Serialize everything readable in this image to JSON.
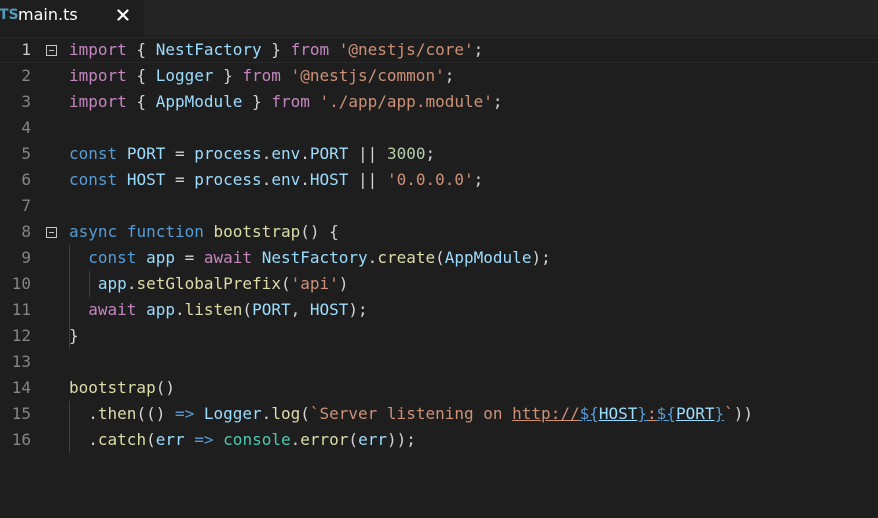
{
  "tab": {
    "icon": "TS",
    "icon_name": "typescript-file-icon",
    "label": "main.ts",
    "close_icon": "close-icon"
  },
  "editor": {
    "fold_icon": "fold-collapse-icon",
    "lines": [
      {
        "number": "1",
        "tokens": [
          {
            "t": "import",
            "c": "kw2"
          },
          {
            "t": " { ",
            "c": "p"
          },
          {
            "t": "NestFactory",
            "c": "id"
          },
          {
            "t": " } ",
            "c": "p"
          },
          {
            "t": "from",
            "c": "kw2"
          },
          {
            "t": " ",
            "c": "p"
          },
          {
            "t": "'@nestjs/core'",
            "c": "str"
          },
          {
            "t": ";",
            "c": "p"
          }
        ]
      },
      {
        "number": "2",
        "tokens": [
          {
            "t": "import",
            "c": "kw2"
          },
          {
            "t": " { ",
            "c": "p"
          },
          {
            "t": "Logger",
            "c": "id"
          },
          {
            "t": " } ",
            "c": "p"
          },
          {
            "t": "from",
            "c": "kw2"
          },
          {
            "t": " ",
            "c": "p"
          },
          {
            "t": "'@nestjs/common'",
            "c": "str"
          },
          {
            "t": ";",
            "c": "p"
          }
        ]
      },
      {
        "number": "3",
        "tokens": [
          {
            "t": "import",
            "c": "kw2"
          },
          {
            "t": " { ",
            "c": "p"
          },
          {
            "t": "AppModule",
            "c": "id"
          },
          {
            "t": " } ",
            "c": "p"
          },
          {
            "t": "from",
            "c": "kw2"
          },
          {
            "t": " ",
            "c": "p"
          },
          {
            "t": "'./app/app.module'",
            "c": "str"
          },
          {
            "t": ";",
            "c": "p"
          }
        ]
      },
      {
        "number": "4",
        "tokens": []
      },
      {
        "number": "5",
        "tokens": [
          {
            "t": "const",
            "c": "kw"
          },
          {
            "t": " ",
            "c": "p"
          },
          {
            "t": "PORT",
            "c": "id"
          },
          {
            "t": " = ",
            "c": "p"
          },
          {
            "t": "process",
            "c": "id"
          },
          {
            "t": ".",
            "c": "p"
          },
          {
            "t": "env",
            "c": "id"
          },
          {
            "t": ".",
            "c": "p"
          },
          {
            "t": "PORT",
            "c": "id"
          },
          {
            "t": " || ",
            "c": "p"
          },
          {
            "t": "3000",
            "c": "num"
          },
          {
            "t": ";",
            "c": "p"
          }
        ]
      },
      {
        "number": "6",
        "tokens": [
          {
            "t": "const",
            "c": "kw"
          },
          {
            "t": " ",
            "c": "p"
          },
          {
            "t": "HOST",
            "c": "id"
          },
          {
            "t": " = ",
            "c": "p"
          },
          {
            "t": "process",
            "c": "id"
          },
          {
            "t": ".",
            "c": "p"
          },
          {
            "t": "env",
            "c": "id"
          },
          {
            "t": ".",
            "c": "p"
          },
          {
            "t": "HOST",
            "c": "id"
          },
          {
            "t": " || ",
            "c": "p"
          },
          {
            "t": "'0.0.0.0'",
            "c": "str"
          },
          {
            "t": ";",
            "c": "p"
          }
        ]
      },
      {
        "number": "7",
        "tokens": []
      },
      {
        "number": "8",
        "tokens": [
          {
            "t": "async",
            "c": "kw"
          },
          {
            "t": " ",
            "c": "p"
          },
          {
            "t": "function",
            "c": "kw"
          },
          {
            "t": " ",
            "c": "p"
          },
          {
            "t": "bootstrap",
            "c": "fn"
          },
          {
            "t": "() {",
            "c": "p"
          }
        ]
      },
      {
        "number": "9",
        "tokens": [
          {
            "t": "  ",
            "c": "p"
          },
          {
            "t": "const",
            "c": "kw"
          },
          {
            "t": " ",
            "c": "p"
          },
          {
            "t": "app",
            "c": "id"
          },
          {
            "t": " = ",
            "c": "p"
          },
          {
            "t": "await",
            "c": "kw2"
          },
          {
            "t": " ",
            "c": "p"
          },
          {
            "t": "NestFactory",
            "c": "id"
          },
          {
            "t": ".",
            "c": "p"
          },
          {
            "t": "create",
            "c": "fn"
          },
          {
            "t": "(",
            "c": "p"
          },
          {
            "t": "AppModule",
            "c": "id"
          },
          {
            "t": ");",
            "c": "p"
          }
        ]
      },
      {
        "number": "10",
        "tokens": [
          {
            "t": "   ",
            "c": "p"
          },
          {
            "t": "app",
            "c": "id"
          },
          {
            "t": ".",
            "c": "p"
          },
          {
            "t": "setGlobalPrefix",
            "c": "fn"
          },
          {
            "t": "(",
            "c": "p"
          },
          {
            "t": "'api'",
            "c": "str"
          },
          {
            "t": ")",
            "c": "p"
          }
        ]
      },
      {
        "number": "11",
        "tokens": [
          {
            "t": "  ",
            "c": "p"
          },
          {
            "t": "await",
            "c": "kw2"
          },
          {
            "t": " ",
            "c": "p"
          },
          {
            "t": "app",
            "c": "id"
          },
          {
            "t": ".",
            "c": "p"
          },
          {
            "t": "listen",
            "c": "fn"
          },
          {
            "t": "(",
            "c": "p"
          },
          {
            "t": "PORT",
            "c": "id"
          },
          {
            "t": ", ",
            "c": "p"
          },
          {
            "t": "HOST",
            "c": "id"
          },
          {
            "t": ");",
            "c": "p"
          }
        ]
      },
      {
        "number": "12",
        "tokens": [
          {
            "t": "}",
            "c": "p"
          }
        ]
      },
      {
        "number": "13",
        "tokens": []
      },
      {
        "number": "14",
        "tokens": [
          {
            "t": "bootstrap",
            "c": "fn"
          },
          {
            "t": "()",
            "c": "p"
          }
        ]
      },
      {
        "number": "15",
        "tokens": [
          {
            "t": "  .",
            "c": "p"
          },
          {
            "t": "then",
            "c": "fn"
          },
          {
            "t": "(() ",
            "c": "p"
          },
          {
            "t": "=>",
            "c": "kw"
          },
          {
            "t": " ",
            "c": "p"
          },
          {
            "t": "Logger",
            "c": "id"
          },
          {
            "t": ".",
            "c": "p"
          },
          {
            "t": "log",
            "c": "fn"
          },
          {
            "t": "(",
            "c": "p"
          },
          {
            "t": "`Server listening on ",
            "c": "str"
          },
          {
            "t": "http://",
            "c": "str link"
          },
          {
            "t": "${",
            "c": "kw link"
          },
          {
            "t": "HOST",
            "c": "id link"
          },
          {
            "t": "}",
            "c": "kw link"
          },
          {
            "t": ":",
            "c": "str link"
          },
          {
            "t": "${",
            "c": "kw link"
          },
          {
            "t": "PORT",
            "c": "id link"
          },
          {
            "t": "}",
            "c": "kw link"
          },
          {
            "t": "`",
            "c": "str"
          },
          {
            "t": "))",
            "c": "p"
          }
        ]
      },
      {
        "number": "16",
        "tokens": [
          {
            "t": "  .",
            "c": "p"
          },
          {
            "t": "catch",
            "c": "fn"
          },
          {
            "t": "(",
            "c": "p"
          },
          {
            "t": "err",
            "c": "id"
          },
          {
            "t": " ",
            "c": "p"
          },
          {
            "t": "=>",
            "c": "kw"
          },
          {
            "t": " ",
            "c": "p"
          },
          {
            "t": "console",
            "c": "cls"
          },
          {
            "t": ".",
            "c": "p"
          },
          {
            "t": "error",
            "c": "fn"
          },
          {
            "t": "(",
            "c": "p"
          },
          {
            "t": "err",
            "c": "id"
          },
          {
            "t": "));",
            "c": "p"
          }
        ]
      }
    ]
  }
}
